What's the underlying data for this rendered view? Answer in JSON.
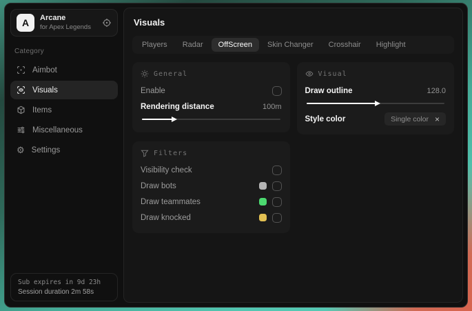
{
  "sidebar": {
    "logo_letter": "A",
    "app_name": "Arcane",
    "app_subtitle": "for Apex Legends",
    "category_label": "Category",
    "items": [
      {
        "label": "Aimbot"
      },
      {
        "label": "Visuals"
      },
      {
        "label": "Items"
      },
      {
        "label": "Miscellaneous"
      },
      {
        "label": "Settings"
      }
    ],
    "footer": {
      "sub_expires": "Sub expires in 9d 23h",
      "session_duration": "Session duration 2m 58s"
    }
  },
  "main": {
    "title": "Visuals",
    "active_tab": "OffScreen",
    "tabs": [
      {
        "label": "Players"
      },
      {
        "label": "Radar"
      },
      {
        "label": "OffScreen"
      },
      {
        "label": "Skin Changer"
      },
      {
        "label": "Crosshair"
      },
      {
        "label": "Highlight"
      }
    ],
    "cards": {
      "general": {
        "title": "General",
        "enable_label": "Enable",
        "rendering_label": "Rendering distance",
        "rendering_value": "100m",
        "slider_fill": "22%"
      },
      "visual": {
        "title": "Visual",
        "outline_label": "Draw outline",
        "outline_value": "128.0",
        "slider_fill": "50%",
        "style_label": "Style color",
        "style_value": "Single color",
        "style_clear": "×"
      },
      "filters": {
        "title": "Filters",
        "rows": [
          {
            "label": "Visibility check",
            "swatch": ""
          },
          {
            "label": "Draw bots",
            "swatch": "#b4b4b4"
          },
          {
            "label": "Draw teammates",
            "swatch": "#4cd970"
          },
          {
            "label": "Draw knocked",
            "swatch": "#e2c052"
          }
        ]
      }
    }
  },
  "colors": {
    "background_teal": "#4fc0ab",
    "background_coral": "#de5f49",
    "accent_white": "#ffffff"
  }
}
